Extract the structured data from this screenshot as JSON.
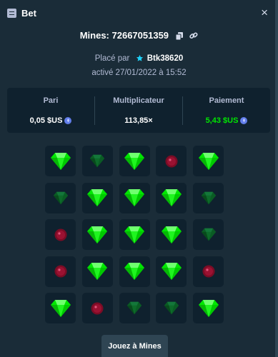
{
  "header": {
    "title": "Bet",
    "close_glyph": "×"
  },
  "bet": {
    "mines_label": "Mines: 72667051359",
    "placed_by_label": "Placé par",
    "username": "Btk38620",
    "activated": "activé 27/01/2022 à 15:52"
  },
  "stats": {
    "bet_label": "Pari",
    "bet_value": "0,05 $US",
    "multiplier_label": "Multiplicateur",
    "multiplier_value": "113,85×",
    "payout_label": "Paiement",
    "payout_value": "5,43 $US"
  },
  "grid": {
    "tiles": [
      "gem",
      "gem-dim",
      "gem",
      "mine",
      "gem",
      "gem-dim",
      "gem",
      "gem",
      "gem",
      "gem-dim",
      "mine",
      "gem",
      "gem",
      "gem",
      "gem-dim",
      "mine",
      "gem",
      "gem",
      "gem",
      "mine",
      "gem",
      "mine",
      "gem-dim",
      "gem-dim",
      "gem"
    ]
  },
  "actions": {
    "play_label": "Jouez à Mines"
  },
  "colors": {
    "background": "#1a2c38",
    "panel": "#0f212e",
    "gem": "#00e701",
    "mine": "#8b0e2a",
    "payout": "#00e701"
  }
}
